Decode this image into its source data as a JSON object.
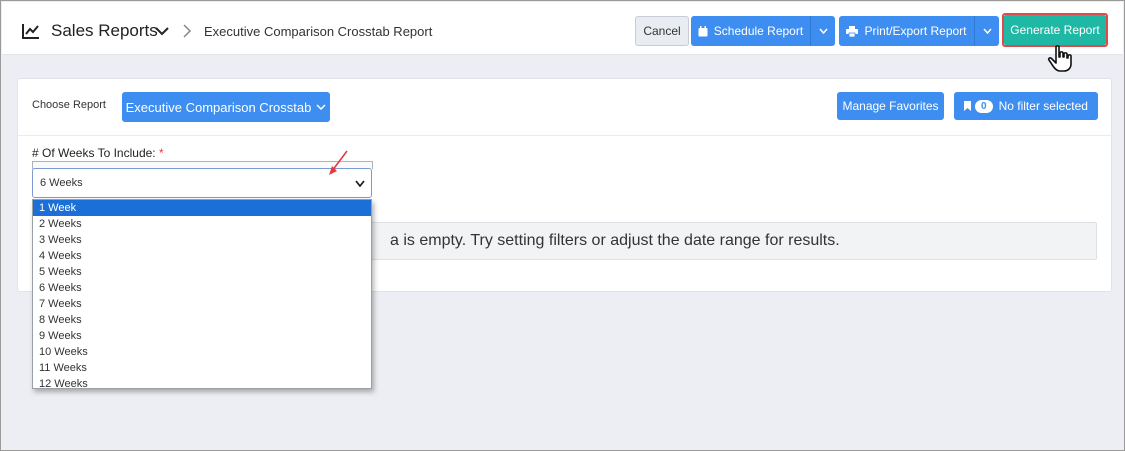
{
  "header": {
    "app_title": "Sales Reports",
    "breadcrumb": "Executive Comparison Crosstab Report",
    "buttons": {
      "cancel": "Cancel",
      "schedule": "Schedule Report",
      "print_export": "Print/Export Report",
      "generate": "Generate Report"
    }
  },
  "toolbar": {
    "choose_report_label": "Choose Report",
    "selected_report": "Executive Comparison Crosstab",
    "manage_favorites": "Manage Favorites",
    "filter_count": "0",
    "filter_text": "No filter selected"
  },
  "weeks": {
    "label": "# Of Weeks To Include:",
    "required_mark": "*",
    "selected_value": "6 Weeks",
    "options": [
      "1 Week",
      "2 Weeks",
      "3 Weeks",
      "4 Weeks",
      "5 Weeks",
      "6 Weeks",
      "7 Weeks",
      "8 Weeks",
      "9 Weeks",
      "10 Weeks",
      "11 Weeks",
      "12 Weeks"
    ],
    "highlighted_option": "1 Week"
  },
  "message": {
    "visible_text": "a is empty. Try setting filters or adjust the date range for results."
  },
  "colors": {
    "primary": "#3d8ef0",
    "generate": "#1fb8a4",
    "highlight_border": "#e04a4a",
    "selected_option": "#1c6fd6"
  },
  "icons": [
    "chart-line-icon",
    "chevron-down-icon",
    "chevron-right-icon",
    "calendar-icon",
    "printer-icon",
    "bookmark-icon",
    "hand-cursor-icon",
    "red-arrow-icon"
  ]
}
